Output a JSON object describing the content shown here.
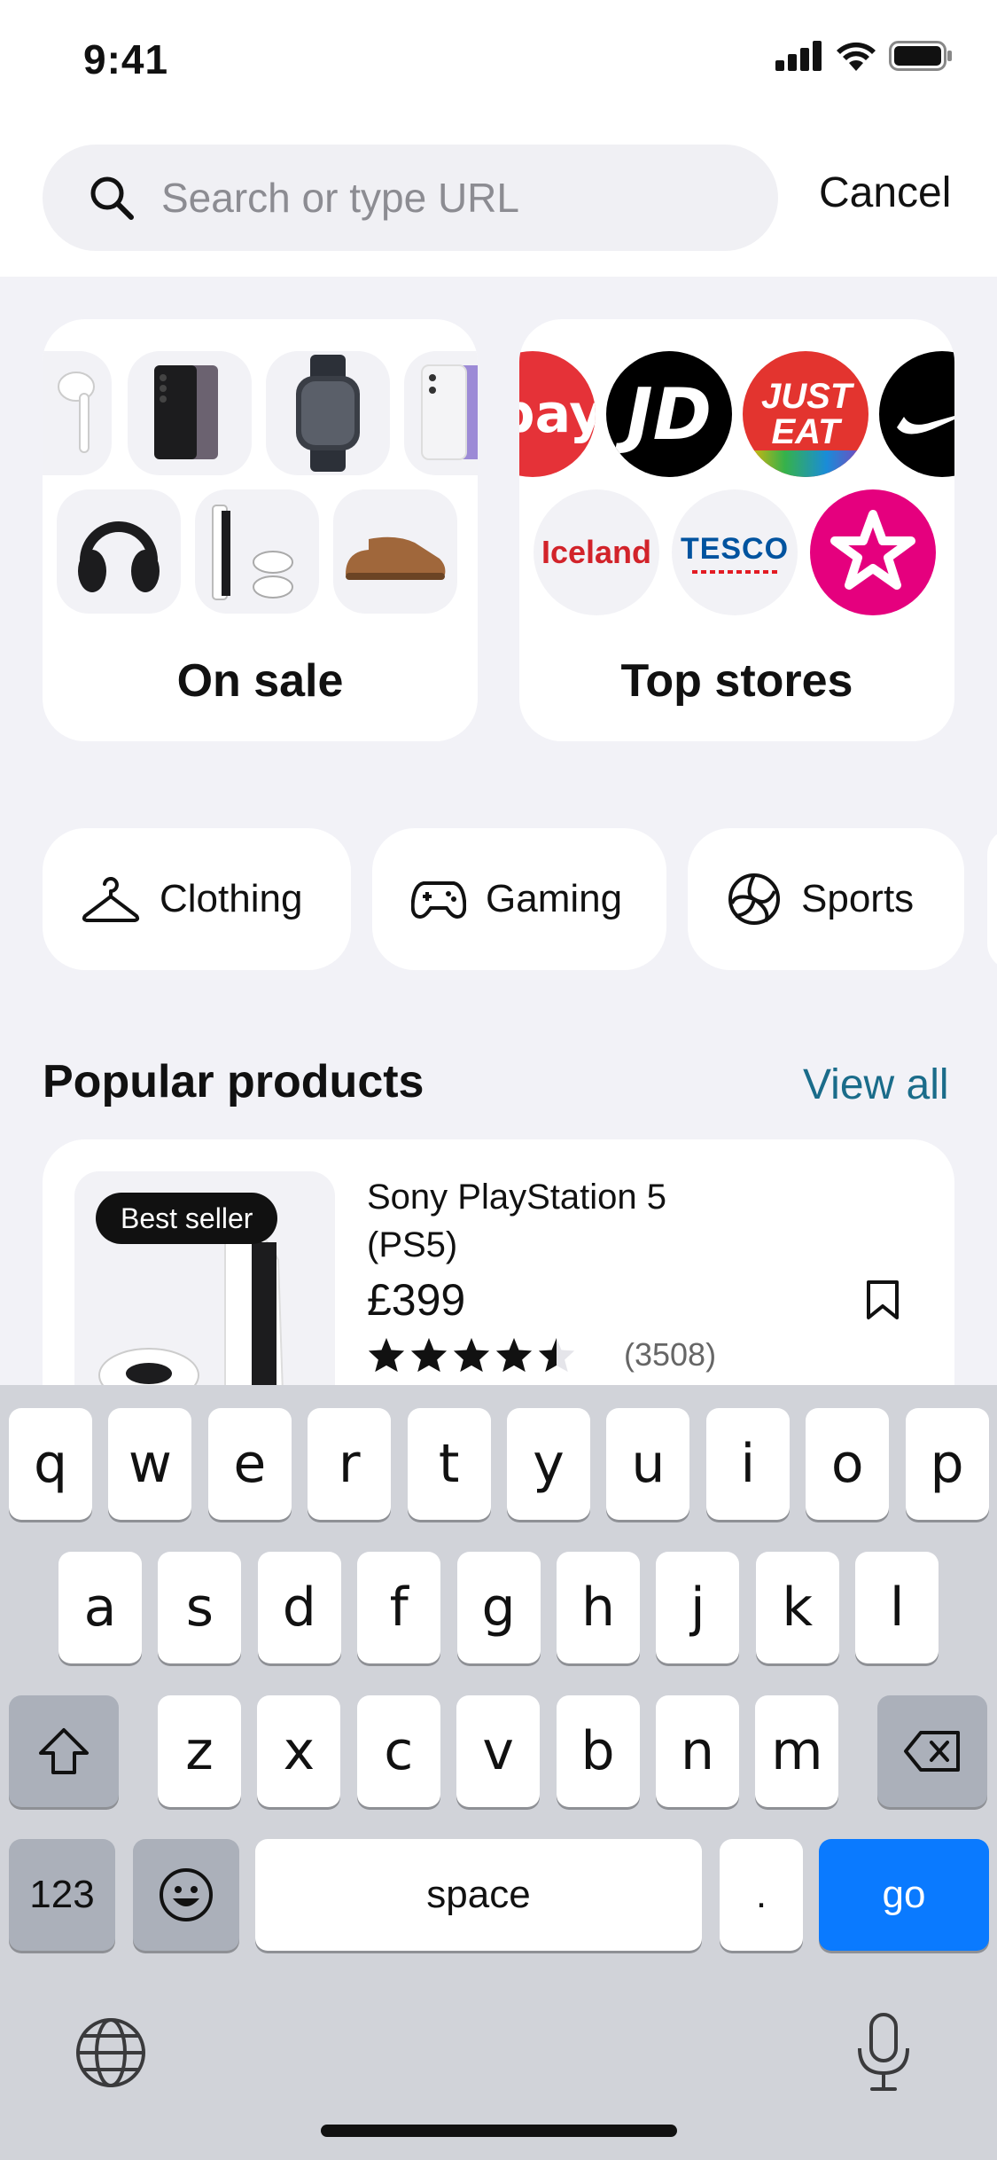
{
  "status_bar": {
    "time": "9:41"
  },
  "search": {
    "placeholder": "Search or type URL",
    "cancel_label": "Cancel"
  },
  "cards": {
    "on_sale": {
      "title": "On sale"
    },
    "top_stores": {
      "title": "Top stores",
      "logos": {
        "ebay": "bay",
        "jd": "JD",
        "just_eat": "JUST EAT",
        "iceland": "Iceland",
        "tesco": "TESCO"
      }
    }
  },
  "categories": [
    {
      "label": "Clothing",
      "icon": "hanger-icon"
    },
    {
      "label": "Gaming",
      "icon": "gamepad-icon"
    },
    {
      "label": "Sports",
      "icon": "volleyball-icon"
    }
  ],
  "popular": {
    "title": "Popular products",
    "view_all": "View all",
    "product": {
      "badge": "Best seller",
      "name": "Sony PlayStation 5 (PS5)",
      "price": "£399",
      "rating": 4.5,
      "reviews": "(3508)"
    }
  },
  "keyboard": {
    "row1": [
      "q",
      "w",
      "e",
      "r",
      "t",
      "y",
      "u",
      "i",
      "o",
      "p"
    ],
    "row2": [
      "a",
      "s",
      "d",
      "f",
      "g",
      "h",
      "j",
      "k",
      "l"
    ],
    "row3": [
      "z",
      "x",
      "c",
      "v",
      "b",
      "n",
      "m"
    ],
    "numbers_label": "123",
    "space_label": "space",
    "period_label": ".",
    "go_label": "go"
  },
  "colors": {
    "accent": "#0a7aff",
    "link": "#1a6c8a",
    "tesco_blue": "#00539f",
    "tesco_red": "#e31b23",
    "iceland_red": "#d2232a",
    "just_eat_red": "#e3342f",
    "store_pink": "#e5007e"
  }
}
